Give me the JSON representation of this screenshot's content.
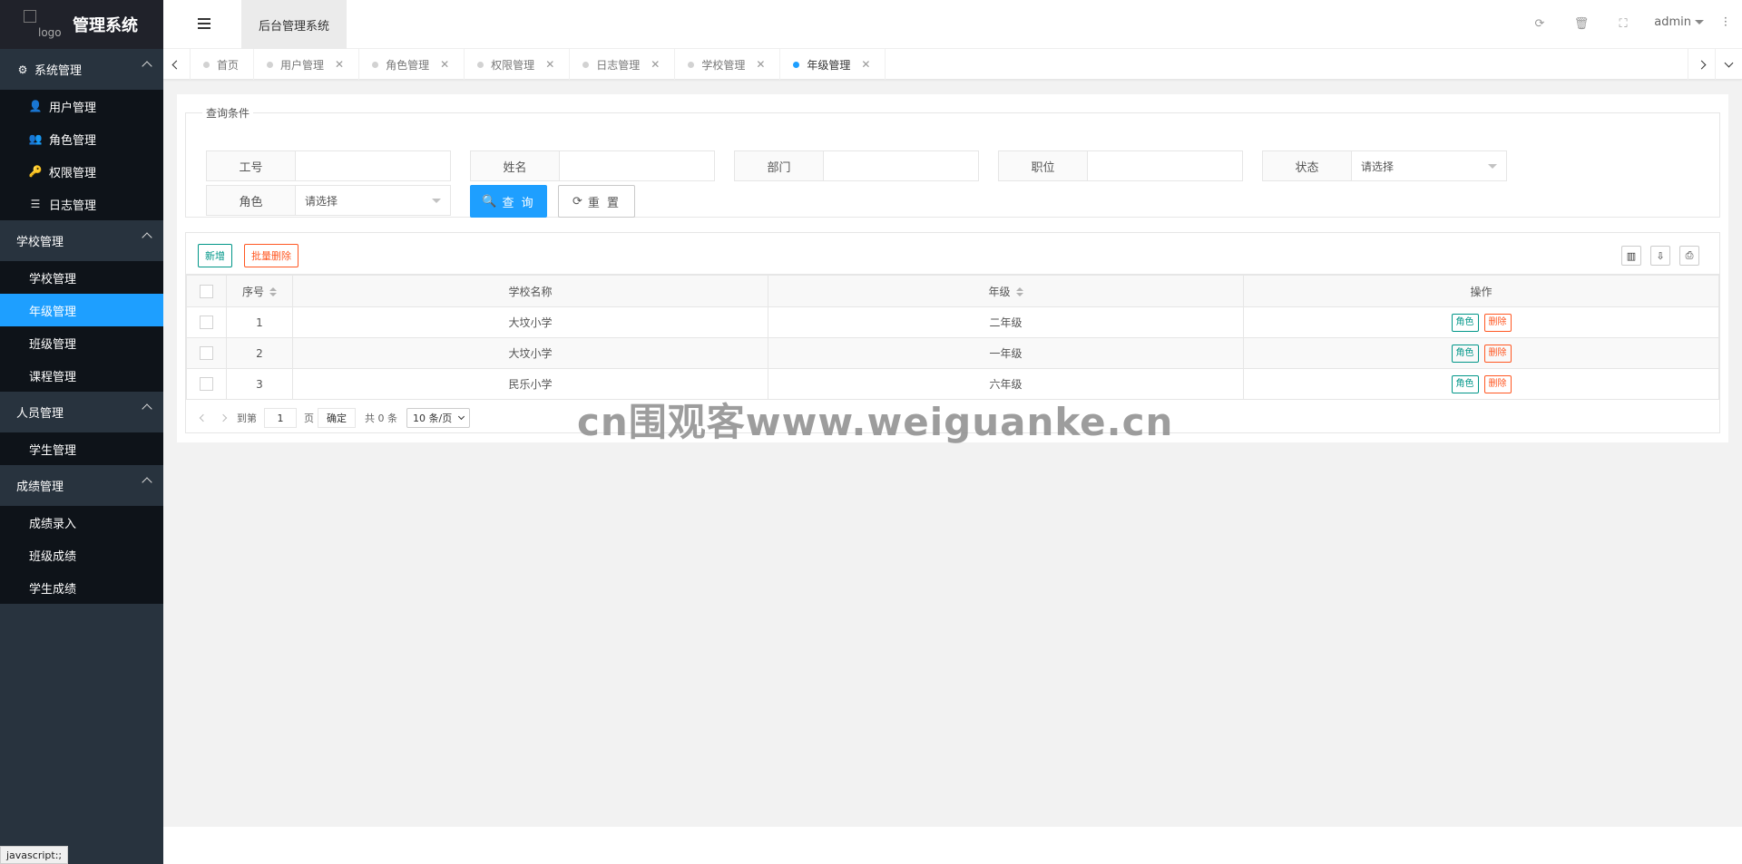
{
  "app": {
    "logo_alt": "logo",
    "title": "管理系统"
  },
  "sidebar": {
    "groups": [
      {
        "label": "系统管理",
        "icon": "gears-icon",
        "items": [
          {
            "label": "用户管理",
            "icon": "user-icon"
          },
          {
            "label": "角色管理",
            "icon": "user-plus-icon"
          },
          {
            "label": "权限管理",
            "icon": "key-icon"
          },
          {
            "label": "日志管理",
            "icon": "list-icon"
          }
        ]
      },
      {
        "label": "学校管理",
        "items": [
          {
            "label": "学校管理"
          },
          {
            "label": "年级管理",
            "active": true
          },
          {
            "label": "班级管理"
          },
          {
            "label": "课程管理"
          }
        ]
      },
      {
        "label": "人员管理",
        "items": [
          {
            "label": "学生管理"
          }
        ]
      },
      {
        "label": "成绩管理",
        "items": [
          {
            "label": "成绩录入"
          },
          {
            "label": "班级成绩"
          },
          {
            "label": "学生成绩"
          }
        ]
      }
    ]
  },
  "header": {
    "tab_label": "后台管理系统",
    "user": "admin"
  },
  "tabs": [
    {
      "label": "首页",
      "closable": false
    },
    {
      "label": "用户管理",
      "closable": true
    },
    {
      "label": "角色管理",
      "closable": true
    },
    {
      "label": "权限管理",
      "closable": true
    },
    {
      "label": "日志管理",
      "closable": true
    },
    {
      "label": "学校管理",
      "closable": true
    },
    {
      "label": "年级管理",
      "closable": true,
      "active": true
    }
  ],
  "query": {
    "legend": "查询条件",
    "fields": {
      "job_no": {
        "label": "工号",
        "value": ""
      },
      "name": {
        "label": "姓名",
        "value": ""
      },
      "dept": {
        "label": "部门",
        "value": ""
      },
      "position": {
        "label": "职位",
        "value": ""
      },
      "status": {
        "label": "状态",
        "value": "请选择"
      },
      "role": {
        "label": "角色",
        "value": "请选择"
      }
    },
    "search_label": "查 询",
    "reset_label": "重 置"
  },
  "toolbar": {
    "add_label": "新增",
    "batch_delete_label": "批量删除"
  },
  "table": {
    "columns": [
      "序号",
      "学校名称",
      "年级",
      "操作"
    ],
    "rows": [
      {
        "no": "1",
        "school": "大坟小学",
        "grade": "二年级"
      },
      {
        "no": "2",
        "school": "大坟小学",
        "grade": "一年级"
      },
      {
        "no": "3",
        "school": "民乐小学",
        "grade": "六年级"
      }
    ],
    "row_actions": {
      "role": "角色",
      "delete": "删除"
    }
  },
  "pager": {
    "goto_label": "到第",
    "page_value": "1",
    "page_unit": "页",
    "confirm_label": "确定",
    "total_text": "共 0 条",
    "page_size": "10 条/页"
  },
  "watermark": "cn围观客www.weiguanke.cn",
  "status_bar": "javascript:;",
  "colors": {
    "accent": "#1e9fff",
    "sidebar_bg": "#28333e",
    "submenu_bg": "#0e1319",
    "green": "#009688",
    "orange": "#ff5722"
  }
}
